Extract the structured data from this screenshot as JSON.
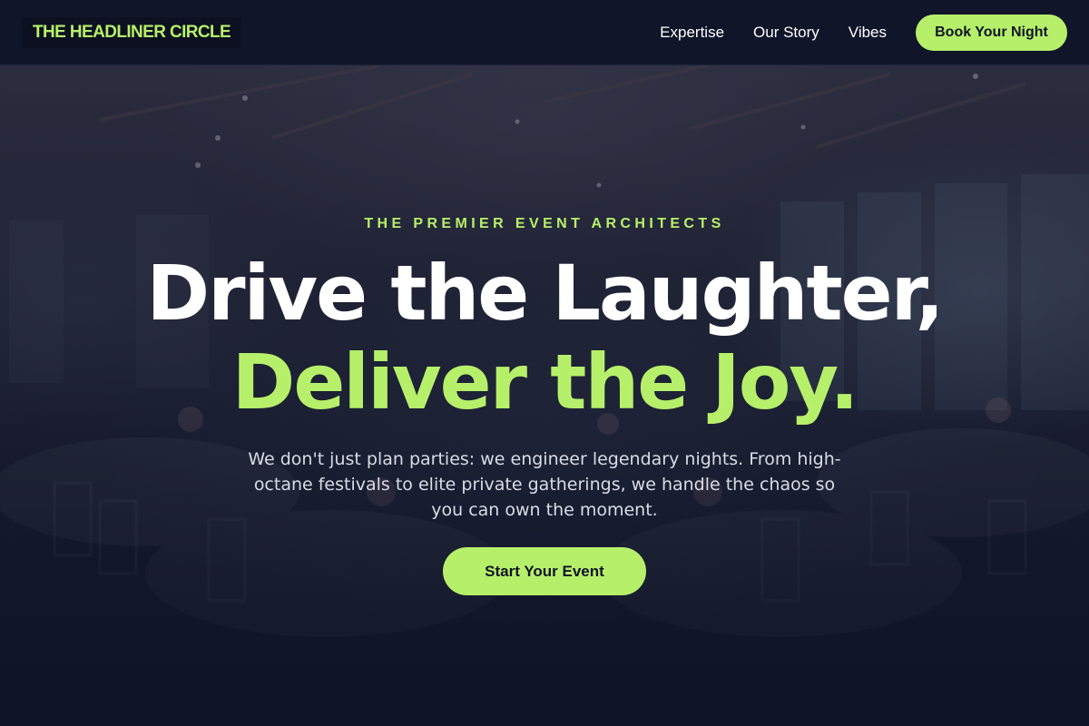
{
  "brand": {
    "name": "THE HEADLINER CIRCLE",
    "accent_color": "#b6f06a",
    "background_color": "#0f1426"
  },
  "nav": {
    "links": [
      "Expertise",
      "Our Story",
      "Vibes"
    ],
    "cta_label": "Book Your Night"
  },
  "hero": {
    "eyebrow": "THE PREMIER EVENT ARCHITECTS",
    "headline_line1": "Drive the Laughter,",
    "headline_line2": "Deliver the Joy.",
    "subtext": "We don't just plan parties: we engineer legendary nights. From high-octane festivals to elite private gatherings, we handle the chaos so you can own the moment.",
    "cta_label": "Start Your Event",
    "background_image": "dim banquet hall with chairs and tables"
  }
}
